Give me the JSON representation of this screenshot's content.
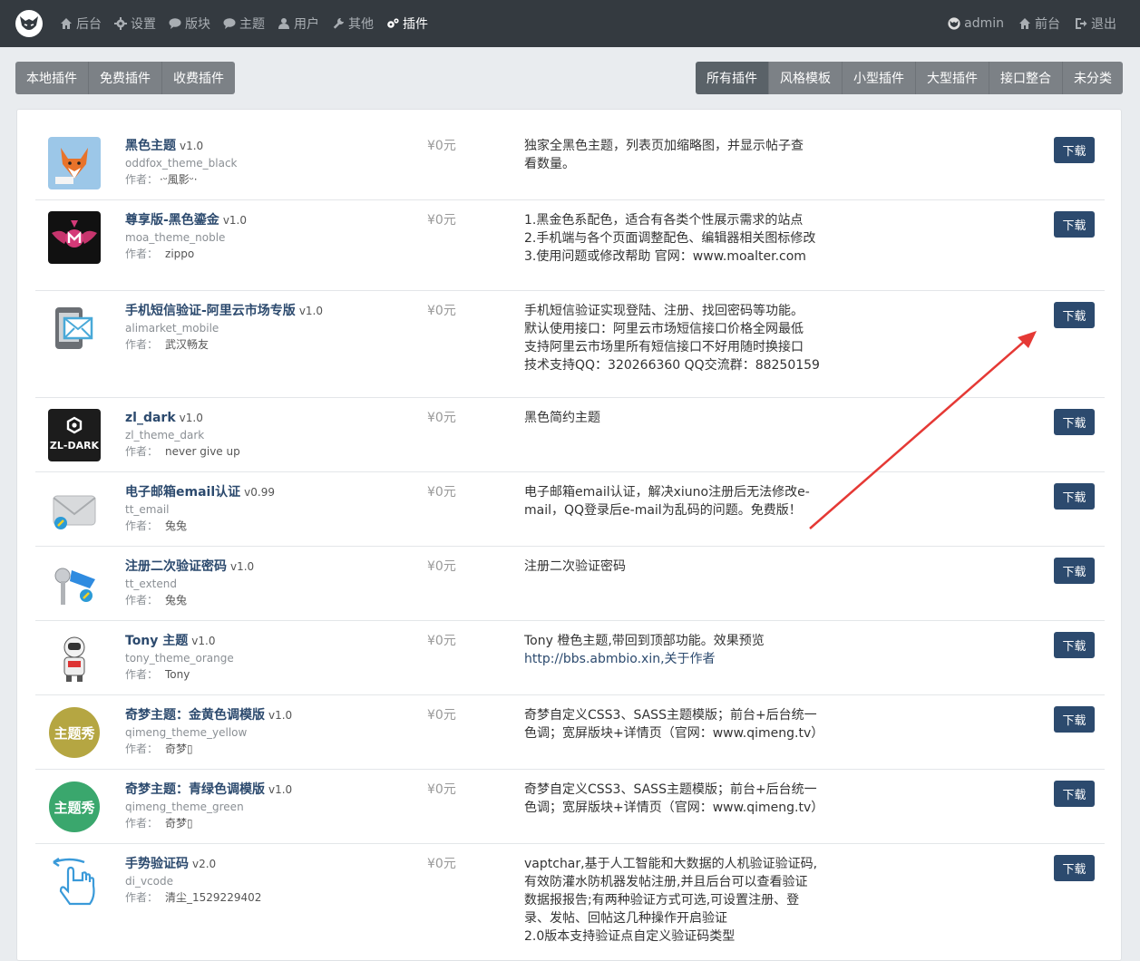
{
  "nav": {
    "left": [
      {
        "icon": "home-icon",
        "label": "后台",
        "active": false
      },
      {
        "icon": "gear-icon",
        "label": "设置",
        "active": false
      },
      {
        "icon": "comment-icon",
        "label": "版块",
        "active": false
      },
      {
        "icon": "comments-icon",
        "label": "主题",
        "active": false
      },
      {
        "icon": "user-icon",
        "label": "用户",
        "active": false
      },
      {
        "icon": "wrench-icon",
        "label": "其他",
        "active": false
      },
      {
        "icon": "cogs-icon",
        "label": "插件",
        "active": true
      }
    ],
    "right": [
      {
        "icon": "avatar-icon",
        "label": "admin"
      },
      {
        "icon": "home-icon",
        "label": "前台"
      },
      {
        "icon": "sign-out-icon",
        "label": "退出"
      }
    ]
  },
  "source_tabs": [
    "本地插件",
    "免费插件",
    "收费插件"
  ],
  "category_tabs": [
    "所有插件",
    "风格模板",
    "小型插件",
    "大型插件",
    "接口整合",
    "未分类"
  ],
  "labels": {
    "author": "作者：",
    "download": "下载"
  },
  "plugins": [
    {
      "title": "黑色主题",
      "version": "v1.0",
      "dir": "oddfox_theme_black",
      "author": "·ᵕ風影ᵕ·",
      "price": "¥0元",
      "desc": [
        "独家全黑色主题，列表页加缩略图，并显示帖子查",
        "看数量。"
      ],
      "icon": "fox-icon"
    },
    {
      "title": "尊享版-黑色鎏金",
      "version": "v1.0",
      "dir": "moa_theme_noble",
      "author": "zippo",
      "price": "¥0元",
      "desc": [
        "1.黑金色系配色，适合有各类个性展示需求的站点",
        "2.手机端与各个页面调整配色、编辑器相关图标修改",
        "3.使用问题或修改帮助 官网：www.moalter.com"
      ],
      "icon": "winged-m-icon"
    },
    {
      "title": "手机短信验证-阿里云市场专版",
      "version": "v1.0",
      "dir": "alimarket_mobile",
      "author": "武汉畅友",
      "price": "¥0元",
      "desc": [
        "手机短信验证实现登陆、注册、找回密码等功能。",
        "默认使用接口：阿里云市场短信接口价格全网最低",
        "支持阿里云市场里所有短信接口不好用随时换接口",
        "技术支持QQ：320266360 QQ交流群：88250159"
      ],
      "icon": "phone-mail-icon"
    },
    {
      "title": "zl_dark",
      "version": "v1.0",
      "dir": "zl_theme_dark",
      "author": "never give up",
      "price": "¥0元",
      "desc": [
        "黑色简约主题"
      ],
      "icon": "zl-dark-logo-icon",
      "logo_text": "ZL-DARK"
    },
    {
      "title": "电子邮箱email认证",
      "version": "v0.99",
      "dir": "tt_email",
      "author": "兔兔",
      "price": "¥0元",
      "desc": [
        "电子邮箱email认证，解决xiuno注册后无法修改e-",
        "mail，QQ登录后e-mail为乱码的问题。免费版！"
      ],
      "icon": "envelope-icon"
    },
    {
      "title": "注册二次验证密码",
      "version": "v1.0",
      "dir": "tt_extend",
      "author": "兔兔",
      "price": "¥0元",
      "desc": [
        "注册二次验证密码"
      ],
      "icon": "key-icon"
    },
    {
      "title": "Tony 主题",
      "version": "v1.0",
      "dir": "tony_theme_orange",
      "author": "Tony",
      "price": "¥0元",
      "desc": [
        "Tony 橙色主题,带回到顶部功能。效果预览",
        "http://bbs.abmbio.xin,关于作者"
      ],
      "icon": "astronaut-icon"
    },
    {
      "title": "奇梦主题：金黄色调模版",
      "version": "v1.0",
      "dir": "qimeng_theme_yellow",
      "author": "奇梦▯",
      "price": "¥0元",
      "desc": [
        "奇梦自定义CSS3、SASS主题模版；前台+后台统一",
        "色调；宽屏版块+详情页（官网：www.qimeng.tv）"
      ],
      "icon": "seal-yellow-icon",
      "logo_text": "主题秀",
      "color": "#b5a642"
    },
    {
      "title": "奇梦主题：青绿色调模版",
      "version": "v1.0",
      "dir": "qimeng_theme_green",
      "author": "奇梦▯",
      "price": "¥0元",
      "desc": [
        "奇梦自定义CSS3、SASS主题模版；前台+后台统一",
        "色调；宽屏版块+详情页（官网：www.qimeng.tv）"
      ],
      "icon": "seal-green-icon",
      "logo_text": "主题秀",
      "color": "#3aa76d"
    },
    {
      "title": "手势验证码",
      "version": "v2.0",
      "dir": "di_vcode",
      "author": "清尘_1529229402",
      "price": "¥0元",
      "desc": [
        "vaptchar,基于人工智能和大数据的人机验证验证码,",
        "有效防灌水防机器发帖注册,并且后台可以查看验证",
        "数据报报告;有两种验证方式可选,可设置注册、登",
        "录、发帖、回帖这几种操作开启验证",
        "2.0版本支持验证点自定义验证码类型"
      ],
      "icon": "swipe-hand-icon"
    }
  ],
  "colors": {
    "navbar": "#343a40",
    "primary": "#2c4a6e",
    "arrow": "#e53935"
  }
}
